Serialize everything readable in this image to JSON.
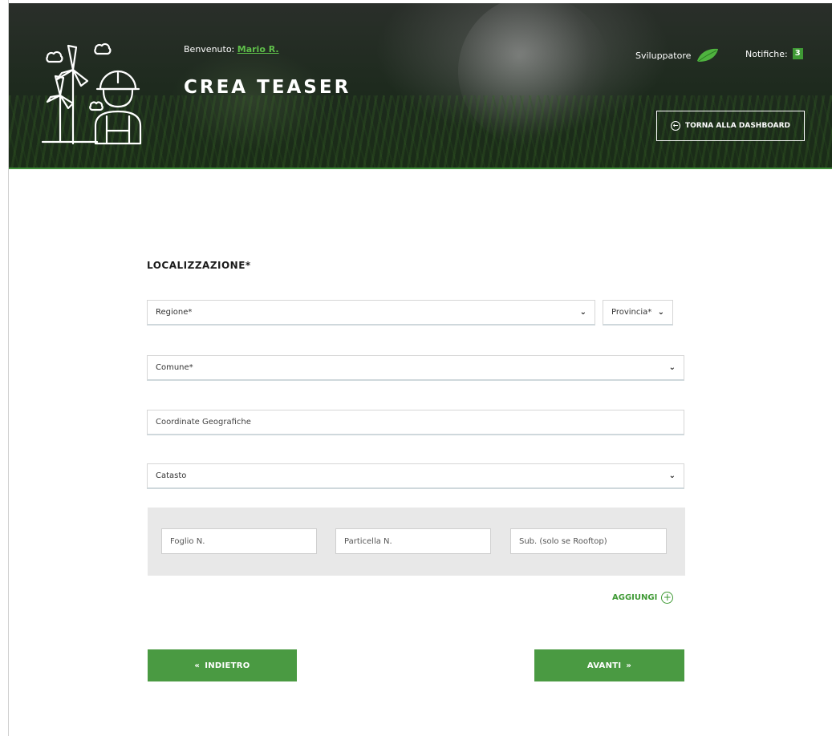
{
  "header": {
    "welcome_label": "Benvenuto:",
    "user_name": "Mario R.",
    "page_title": "CREA TEASER",
    "role": "Sviluppatore",
    "notifications_label": "Notifiche:",
    "notifications_count": "3",
    "back_dashboard_label": "TORNA ALLA DASHBOARD",
    "icons": {
      "logo": "wind-turbine-worker-logo",
      "role": "leaf-icon",
      "back": "arrow-left-circle-icon"
    }
  },
  "form": {
    "section_title": "LOCALIZZAZIONE*",
    "regione": {
      "placeholder": "Regione*"
    },
    "provincia": {
      "placeholder": "Provincia*"
    },
    "comune": {
      "placeholder": "Comune*"
    },
    "coordinate": {
      "placeholder": "Coordinate Geografiche"
    },
    "catasto": {
      "placeholder": "Catasto"
    },
    "catasto_fields": {
      "foglio": "Foglio N.",
      "particella": "Particella N.",
      "sub": "Sub. (solo se Rooftop)"
    },
    "add_label": "AGGIUNGI"
  },
  "nav": {
    "back_label": "INDIETRO",
    "next_label": "AVANTI"
  },
  "colors": {
    "accent": "#4a9a42",
    "header_bg": "#1d2a1d",
    "panel_bg": "#e8e8e8"
  }
}
